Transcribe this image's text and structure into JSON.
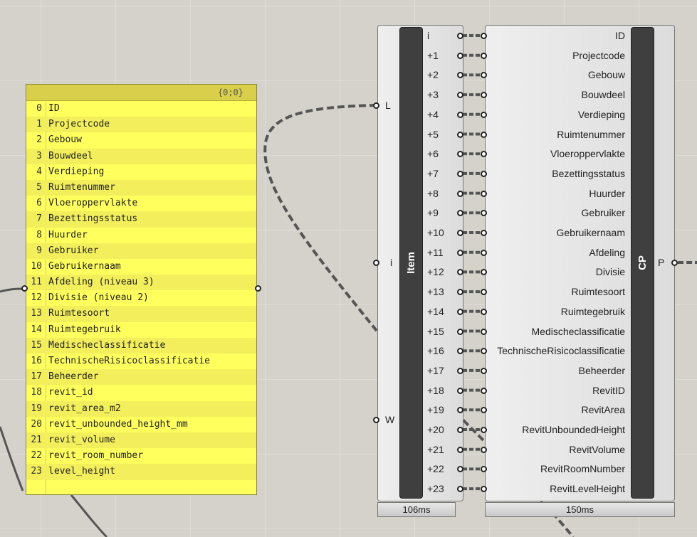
{
  "panel": {
    "header": "{0;0}",
    "items": [
      {
        "index": "0",
        "value": "ID"
      },
      {
        "index": "1",
        "value": "Projectcode"
      },
      {
        "index": "2",
        "value": "Gebouw"
      },
      {
        "index": "3",
        "value": "Bouwdeel"
      },
      {
        "index": "4",
        "value": "Verdieping"
      },
      {
        "index": "5",
        "value": "Ruimtenummer"
      },
      {
        "index": "6",
        "value": "Vloeroppervlakte"
      },
      {
        "index": "7",
        "value": "Bezettingsstatus"
      },
      {
        "index": "8",
        "value": "Huurder"
      },
      {
        "index": "9",
        "value": "Gebruiker"
      },
      {
        "index": "10",
        "value": "Gebruikernaam"
      },
      {
        "index": "11",
        "value": "Afdeling (niveau 3)"
      },
      {
        "index": "12",
        "value": "Divisie (niveau 2)"
      },
      {
        "index": "13",
        "value": "Ruimtesoort"
      },
      {
        "index": "14",
        "value": "Ruimtegebruik"
      },
      {
        "index": "15",
        "value": "Medischeclassificatie"
      },
      {
        "index": "16",
        "value": "TechnischeRisicoclassificatie"
      },
      {
        "index": "17",
        "value": "Beheerder"
      },
      {
        "index": "18",
        "value": "revit_id"
      },
      {
        "index": "19",
        "value": "revit_area_m2"
      },
      {
        "index": "20",
        "value": "revit_unbounded_height_mm"
      },
      {
        "index": "21",
        "value": "revit_volume"
      },
      {
        "index": "22",
        "value": "revit_room_number"
      },
      {
        "index": "23",
        "value": "level_height"
      }
    ]
  },
  "item_component": {
    "name": "Item",
    "inputs": [
      "L",
      "i",
      "W"
    ],
    "outputs": [
      "i",
      "+1",
      "+2",
      "+3",
      "+4",
      "+5",
      "+6",
      "+7",
      "+8",
      "+9",
      "+10",
      "+11",
      "+12",
      "+13",
      "+14",
      "+15",
      "+16",
      "+17",
      "+18",
      "+19",
      "+20",
      "+21",
      "+22",
      "+23"
    ],
    "timing": "106ms"
  },
  "cp_component": {
    "name": "CP",
    "inputs": [
      "ID",
      "Projectcode",
      "Gebouw",
      "Bouwdeel",
      "Verdieping",
      "Ruimtenummer",
      "Vloeroppervlakte",
      "Bezettingsstatus",
      "Huurder",
      "Gebruiker",
      "Gebruikernaam",
      "Afdeling",
      "Divisie",
      "Ruimtesoort",
      "Ruimtegebruik",
      "Medischeclassificatie",
      "TechnischeRisicoclassificatie",
      "Beheerder",
      "RevitID",
      "RevitArea",
      "RevitUnboundedHeight",
      "RevitVolume",
      "RevitRoomNumber",
      "RevitLevelHeight"
    ],
    "output": "P",
    "timing": "150ms"
  },
  "colors": {
    "canvas": "#d5d2cb",
    "panel_bg": "#ffff5e",
    "panel_header": "#d9cf4a",
    "component_core": "#3f3f3f",
    "wire": "#555555"
  }
}
